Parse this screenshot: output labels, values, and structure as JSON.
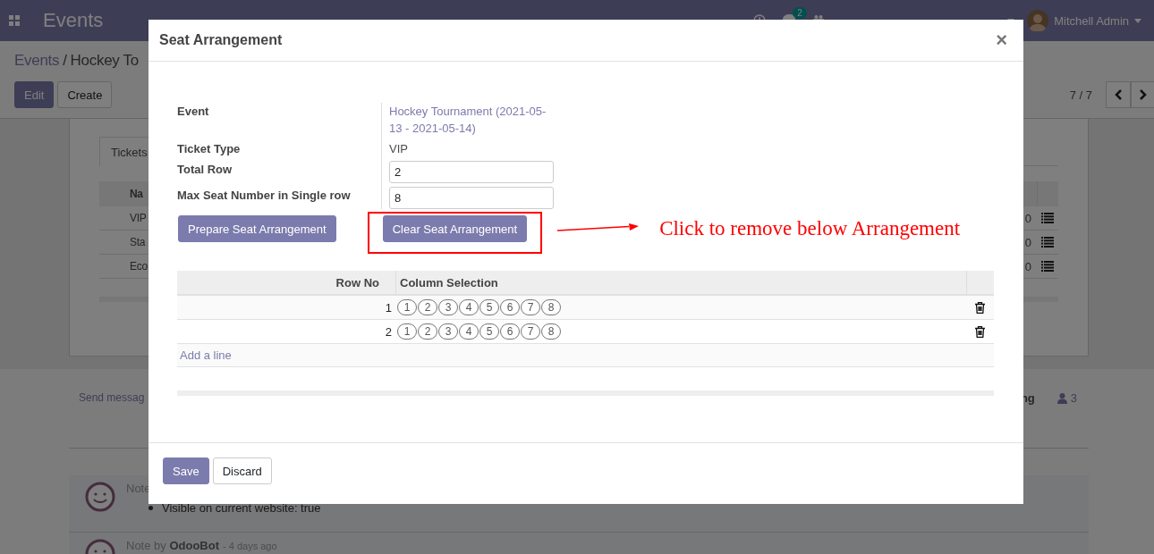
{
  "navbar": {
    "app_title": "Events",
    "chat_badge": "2",
    "user": "Mitchell Admin"
  },
  "breadcrumb": {
    "parent": "Events",
    "separator": "/",
    "current": "Hockey To"
  },
  "control_buttons": [
    {
      "label": "Edit",
      "kind": "primary"
    },
    {
      "label": "Create",
      "kind": "secondary"
    }
  ],
  "pager": "7 / 7",
  "sheet": {
    "tab": "Tickets",
    "header": "Na",
    "rows": [
      {
        "name": "VIP",
        "count": "0"
      },
      {
        "name": "Sta",
        "count": "0"
      },
      {
        "name": "Eco",
        "count": "0"
      }
    ]
  },
  "chatter": {
    "send_message": "Send messag",
    "following": "ng",
    "followers": "3",
    "messages": [
      {
        "header": "Note",
        "bullet": "Visible on current website: true"
      },
      {
        "header": "Note by **OdooBot**",
        "time": "- 4 days ago"
      }
    ]
  },
  "dialog": {
    "title": "Seat Arrangement",
    "close": "×",
    "fields": [
      {
        "label": "Event",
        "kind": "link",
        "value": "Hockey Tournament (2021-05-13 - 2021-05-14)"
      },
      {
        "label": "Ticket Type",
        "kind": "text",
        "value": "VIP"
      },
      {
        "label": "Total Row",
        "kind": "input",
        "value": "2"
      },
      {
        "label": "Max Seat Number in Single row",
        "kind": "input",
        "value": "8"
      }
    ],
    "actions": [
      {
        "label": "Prepare Seat Arrangement",
        "highlighted": false
      },
      {
        "label": "Clear Seat Arrangement",
        "highlighted": true
      }
    ],
    "annotation": "Click to remove below Arrangement",
    "table": {
      "columns": [
        "Row No",
        "Column Selection"
      ],
      "rows": [
        {
          "row_no": "1",
          "seats": [
            "1",
            "2",
            "3",
            "4",
            "5",
            "6",
            "7",
            "8"
          ]
        },
        {
          "row_no": "2",
          "seats": [
            "1",
            "2",
            "3",
            "4",
            "5",
            "6",
            "7",
            "8"
          ]
        }
      ],
      "add_line": "Add a line"
    },
    "footer": [
      {
        "label": "Save",
        "kind": "primary"
      },
      {
        "label": "Discard",
        "kind": "secondary"
      }
    ]
  }
}
